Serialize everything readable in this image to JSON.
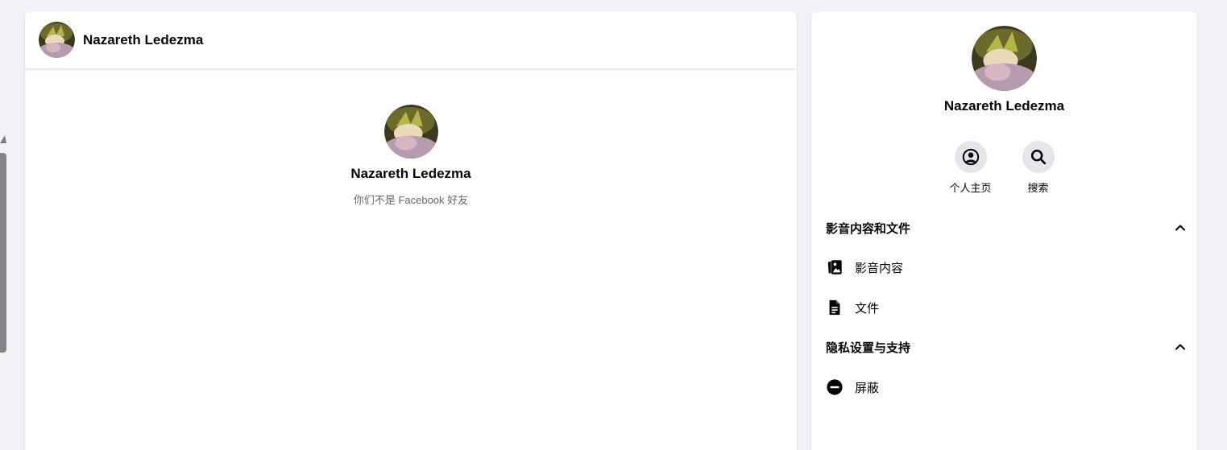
{
  "chat": {
    "contact_name": "Nazareth Ledezma",
    "intro_name": "Nazareth Ledezma",
    "friend_status": "你们不是 Facebook 好友"
  },
  "info": {
    "contact_name": "Nazareth Ledezma",
    "actions": [
      {
        "label": "个人主页",
        "icon": "profile-icon"
      },
      {
        "label": "搜索",
        "icon": "search-icon"
      }
    ],
    "sections": [
      {
        "title": "影音内容和文件",
        "expanded": true,
        "items": [
          {
            "label": "影音内容",
            "icon": "media-icon"
          },
          {
            "label": "文件",
            "icon": "file-icon"
          }
        ]
      },
      {
        "title": "隐私设置与支持",
        "expanded": true,
        "items": [
          {
            "label": "屏蔽",
            "icon": "block-icon"
          }
        ]
      }
    ]
  },
  "colors": {
    "background": "#f0f2f5",
    "panel": "#ffffff",
    "text_primary": "#050505",
    "text_secondary": "#65676b",
    "action_circle": "#e4e6eb"
  }
}
